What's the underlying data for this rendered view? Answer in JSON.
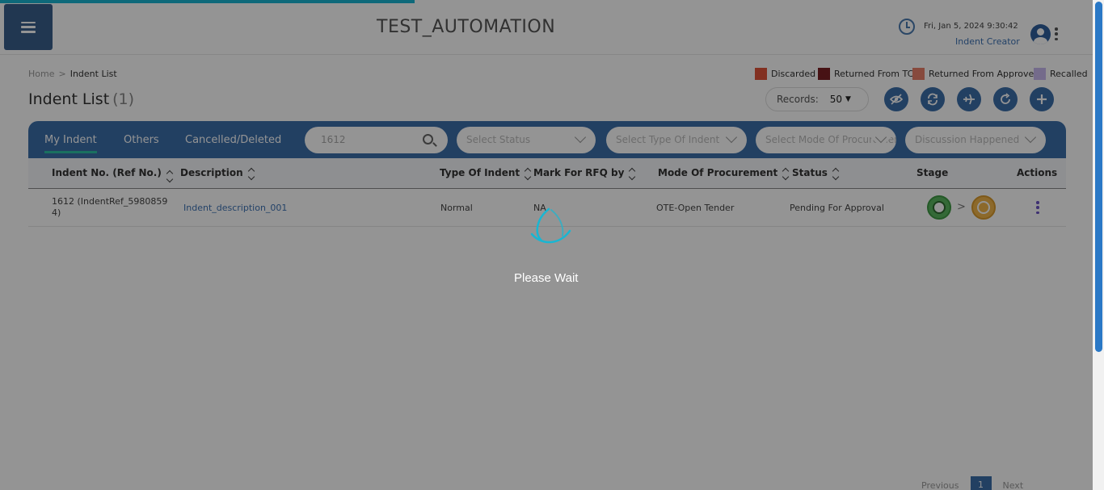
{
  "header": {
    "app_title": "TEST_AUTOMATION",
    "datetime": "Fri, Jan 5, 2024 9:30:42",
    "role": "Indent Creator"
  },
  "breadcrumb": {
    "home": "Home",
    "sep": ">",
    "current": "Indent List"
  },
  "legend": [
    {
      "label": "Discarded",
      "color": "#e0533a"
    },
    {
      "label": "Returned From TC",
      "color": "#7a1f24"
    },
    {
      "label": "Returned From Approver",
      "color": "#e8806a"
    },
    {
      "label": "Recalled",
      "color": "#c9b8ef"
    }
  ],
  "page": {
    "title": "Indent List",
    "count": "(1)"
  },
  "records": {
    "label": "Records:",
    "value": "50"
  },
  "toolbar_icons": [
    "eye-off-icon",
    "refresh-icon",
    "plane-icon",
    "reload-icon",
    "plus-icon"
  ],
  "tabs": [
    "My Indent",
    "Others",
    "Cancelled/Deleted"
  ],
  "filters": {
    "search_value": "1612",
    "status": "Select Status",
    "type": "Select Type Of Indent",
    "mode": "Select Mode Of Procurement",
    "discussion": "Discussion Happened"
  },
  "columns": [
    "Indent No. (Ref No.)",
    "Description",
    "Type Of Indent",
    "Mark For RFQ by",
    "Mode Of Procurement",
    "Status",
    "Stage",
    "Actions"
  ],
  "rows": [
    {
      "indent_no_line1": "1612 (IndentRef_5980859",
      "indent_no_line2": "4)",
      "description": "Indent_description_001",
      "type": "Normal",
      "rfq": "NA",
      "mode": "OTE-Open Tender",
      "status": "Pending For Approval",
      "stage_arrow": ">"
    }
  ],
  "pagination": {
    "prev": "Previous",
    "page": "1",
    "next": "Next"
  },
  "loading": {
    "text": "Please Wait"
  },
  "colors": {
    "primary": "#3b6eaa",
    "accent": "#19b6d2",
    "tab_indicator": "#2ec1a6"
  }
}
